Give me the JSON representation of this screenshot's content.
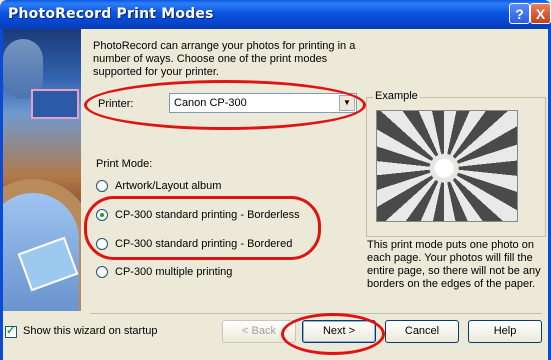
{
  "window": {
    "title": "PhotoRecord Print Modes",
    "help_glyph": "?",
    "close_glyph": "X"
  },
  "intro": "PhotoRecord can arrange your photos for printing in a number of ways. Choose one of the print modes supported for your printer.",
  "printer": {
    "label": "Printer:",
    "value": "Canon CP-300",
    "dropdown_glyph": "▼"
  },
  "print_mode": {
    "label": "Print Mode:",
    "options": [
      {
        "label": "Artwork/Layout album",
        "selected": false
      },
      {
        "label": "CP-300 standard printing - Borderless",
        "selected": true
      },
      {
        "label": "CP-300 standard printing - Bordered",
        "selected": false
      },
      {
        "label": "CP-300 multiple printing",
        "selected": false
      }
    ]
  },
  "example": {
    "label": "Example",
    "description": "This print mode puts one photo on each page. Your photos will fill the entire page, so there will not be any borders on the edges of the paper."
  },
  "startup_checkbox": {
    "label": "Show this wizard on startup",
    "checked": true
  },
  "buttons": {
    "back": "< Back",
    "next": "Next >",
    "cancel": "Cancel",
    "help": "Help"
  },
  "colors": {
    "annotation": "#e11212",
    "titlebar": "#0a54e0"
  }
}
